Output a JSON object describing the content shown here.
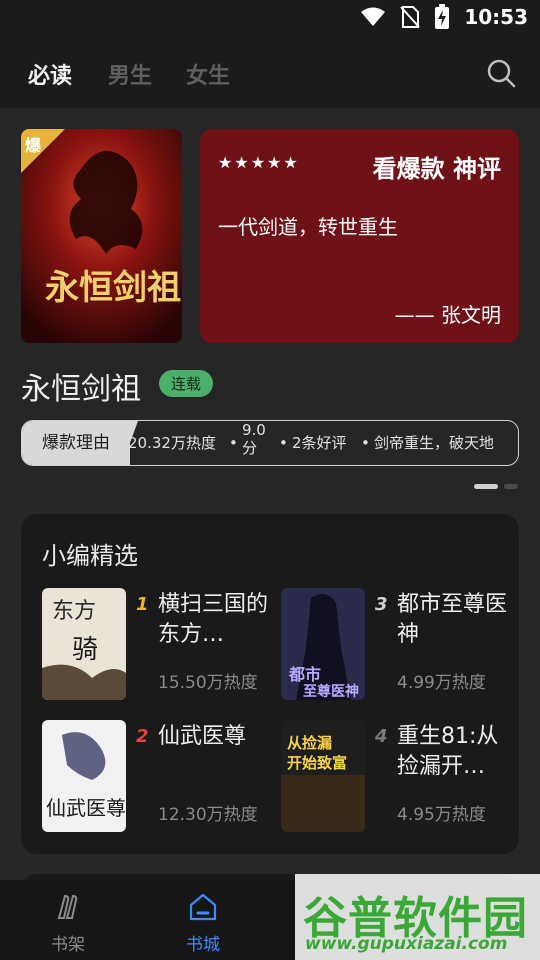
{
  "status_bar": {
    "time": "10:53"
  },
  "top_tabs": [
    {
      "label": "必读",
      "active": true
    },
    {
      "label": "男生",
      "active": false
    },
    {
      "label": "女生",
      "active": false
    }
  ],
  "featured": {
    "cover_badge": "爆",
    "cover_title": "永恒剑祖",
    "review_title": "看爆款 神评",
    "review_quote": "一代剑道，转世重生",
    "review_author": "—— 张文明",
    "stars": 5,
    "book_title": "永恒剑祖",
    "status_badge": "连载",
    "reason_tag": "爆款理由",
    "heat": "20.32万热度",
    "score": "9.0",
    "score_unit": "分",
    "reviews": "2条好评",
    "tagline": "剑帝重生，破天地",
    "separator": "•"
  },
  "picks": {
    "title": "小编精选",
    "items": [
      {
        "rank": "1",
        "name": "横扫三国的东方…",
        "heat": "15.50万热度",
        "rank_color": "#f0b429"
      },
      {
        "rank": "3",
        "name": "都市至尊医神",
        "heat": "4.99万热度",
        "rank_color": "#cfcfcf"
      },
      {
        "rank": "2",
        "name": "仙武医尊",
        "heat": "12.30万热度",
        "rank_color": "#e0463b"
      },
      {
        "rank": "4",
        "name": "重生81:从捡漏开…",
        "heat": "4.95万热度",
        "rank_color": "#7a7a7a"
      }
    ]
  },
  "bottom_nav": [
    {
      "label": "书架",
      "icon": "bookshelf-icon",
      "active": false
    },
    {
      "label": "书城",
      "icon": "bookstore-icon",
      "active": true
    }
  ],
  "watermark": {
    "main": "谷普软件园",
    "url": "www.gupuxiazai.com"
  },
  "colors": {
    "accent": "#3d8bfd",
    "review_bg": "#6e1218",
    "badge": "#4caf6a"
  }
}
